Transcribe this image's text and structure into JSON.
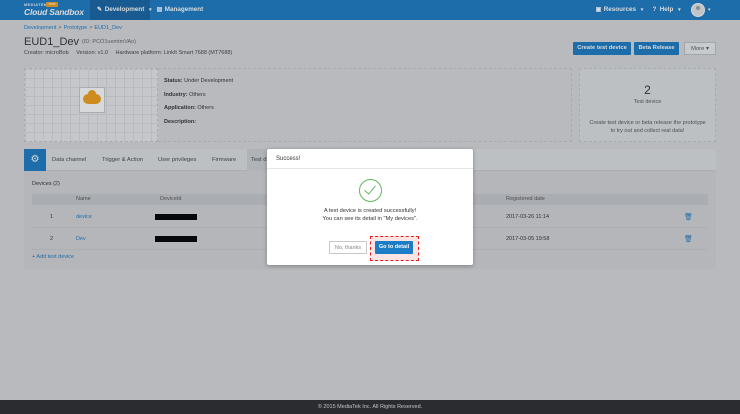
{
  "header": {
    "brand": "MEDIATEK",
    "badge": "beta",
    "product": "Cloud Sandbox",
    "nav": [
      {
        "label": "Development",
        "icon": "wrench-icon",
        "caret": "▾"
      },
      {
        "label": "Management",
        "icon": "clipboard-icon"
      }
    ],
    "resources_label": "Resources",
    "help_label": "Help",
    "caret": "▾",
    "colors": {
      "nav_bg": "#1d7cc6",
      "nav_active": "#1666a5"
    }
  },
  "breadcrumb": [
    "Development",
    "Prototype",
    "EUD1_Dev"
  ],
  "breadcrumb_sep": ">",
  "prototype": {
    "title": "EUD1_Dev",
    "id_text": "(ID: PCO1uemtmVAo)",
    "creator": "Creator: microBob",
    "version": "Version: v1.0",
    "platform": "Hardware platform: LinkIt Smart 7688 (MT7688)",
    "status_label": "Status:",
    "status_value": "Under Development",
    "industry_label": "Industry:",
    "industry_value": "Others",
    "application_label": "Application:",
    "application_value": "Others",
    "description_label": "Description:"
  },
  "actions": {
    "create_test_device": "Create test device",
    "beta_release": "Beta Release",
    "more": "More",
    "more_caret": "▾"
  },
  "test_device_box": {
    "count": "2",
    "label": "Test device",
    "hint": "Create test device or beta release the prototype to try out and collect real data!"
  },
  "tabs": {
    "gear_icon": "⚙",
    "items": [
      "Data channel",
      "Trigger & Action",
      "User privileges",
      "Firmware",
      "Test d"
    ]
  },
  "devices": {
    "label": "Devices (2)",
    "columns": [
      "Name",
      "DeviceId",
      "Registered date"
    ],
    "rows": [
      {
        "index": "1",
        "name": "device",
        "registered": "2017-03-26 11:14"
      },
      {
        "index": "2",
        "name": "Dev",
        "registered": "2017-03-05 19:58"
      }
    ],
    "trash_icon": "🗑",
    "add_link": "+ Add test device"
  },
  "footer": "© 2015 MediaTek Inc. All Rights Reserved.",
  "modal": {
    "title": "Success!",
    "message_line1": "A test device is created successfully!",
    "message_line2": "You can see its detail in \"My devices\".",
    "cancel_label": "No, thanks",
    "confirm_label": "Go to detail",
    "highlight_color": "#e11d1d"
  }
}
